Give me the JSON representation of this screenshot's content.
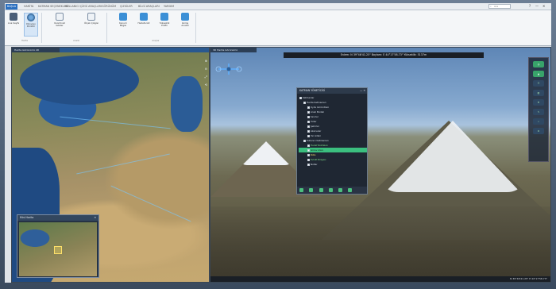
{
  "ribbon_tabs": [
    "BAŞLA",
    "HARİTA",
    "KATMAN SEÇENEKLERİ",
    "KULLANICI ÇİZGİ ARAÇLARI",
    "GÖRÜNÜM",
    "ÇIZGİLER",
    "BİLGİ ARAÇLARI",
    "YARDIM"
  ],
  "ribbon_active_tab": 0,
  "search": {
    "placeholder": "Ara"
  },
  "window_controls": [
    "?",
    "—",
    "✕"
  ],
  "ribbon_buttons": [
    {
      "label": "Ana Sayfa",
      "icon": "home-icon"
    },
    {
      "label": "Dünyayı Döndür",
      "icon": "globe-icon",
      "selected": true
    },
    {
      "label": "Koordinat Göster",
      "icon": "document-icon"
    },
    {
      "label": "Ölçek Çizgisi",
      "icon": "ruler-icon"
    },
    {
      "label": "Konum Bilgisi",
      "icon": "pin-icon"
    },
    {
      "label": "Hedefe Git",
      "icon": "target-icon"
    },
    {
      "label": "Yükseklik Profili",
      "icon": "profile-icon"
    },
    {
      "label": "Görüş Analizi",
      "icon": "eye-icon"
    }
  ],
  "ribbon_groups": [
    "Harita",
    "Analiz",
    "Araçlar"
  ],
  "left_pane": {
    "title": "Harita Görünümü 2D",
    "map_controls": [
      "⊕",
      "⊖",
      "⤢",
      "⟲"
    ],
    "minimap": {
      "title": "Mini Harita"
    }
  },
  "right_pane": {
    "title": "3D Harita Görünümü",
    "coordinates": "Enlem: N 39°46'41.25\" Boylam: E 44°17'58.73\" Yükseklik: 5137m",
    "status_left": "",
    "status_right": "N 39°46'41.25\" E 44°17'58.73\"",
    "tools": [
      "◎",
      "▲",
      "☰",
      "◧",
      "⚑",
      "✎",
      "⌖",
      "⚙"
    ]
  },
  "layer_dialog": {
    "title": "KATMAN YÖNETİCİSİ",
    "items": [
      {
        "label": "Katmanlar",
        "level": 0
      },
      {
        "label": "Harita Katmanları",
        "level": 1
      },
      {
        "label": "Uydu Görüntüsü",
        "level": 2
      },
      {
        "label": "Arazi Modeli",
        "level": 2
      },
      {
        "label": "Sınırlar",
        "level": 2
      },
      {
        "label": "Yollar",
        "level": 2
      },
      {
        "label": "Şehirler",
        "level": 2
      },
      {
        "label": "Akarsular",
        "level": 2
      },
      {
        "label": "Yer Adları",
        "level": 2
      },
      {
        "label": "Kullanıcı Katmanları",
        "level": 1
      },
      {
        "label": "Hedef Noktaları",
        "level": 2,
        "style": "green"
      },
      {
        "label": "Görev Alanı",
        "level": 2,
        "style": "hl"
      },
      {
        "label": "Rota",
        "level": 2,
        "style": "yellow"
      },
      {
        "label": "Tehdit Bölgesi",
        "level": 2,
        "style": "green"
      },
      {
        "label": "Notlar",
        "level": 2
      }
    ]
  }
}
